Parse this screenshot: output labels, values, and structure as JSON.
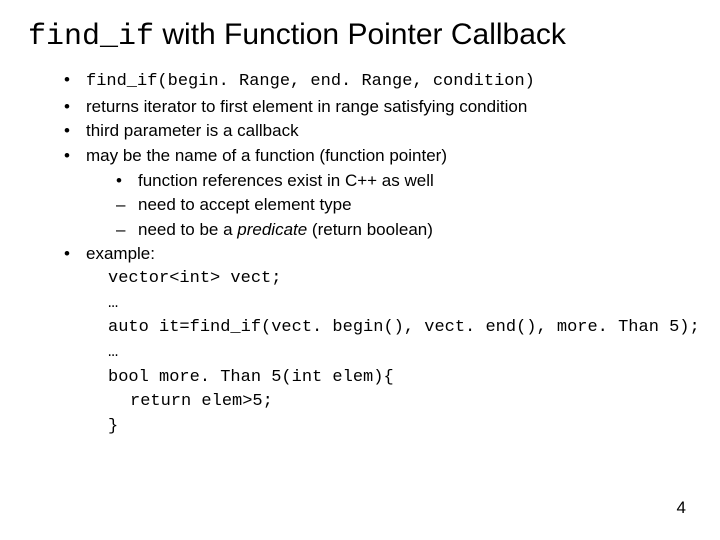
{
  "title": {
    "code": "find_if",
    "rest": " with Function Pointer Callback"
  },
  "bullets": {
    "b1": "find_if(begin. Range, end. Range, condition)",
    "b2": "returns iterator to first element in range satisfying condition",
    "b3": "third parameter is a callback",
    "b4": {
      "main": "may be the name of a function (function pointer)",
      "sub1": "function references exist in C++ as well",
      "sub2": "need to accept element type",
      "sub3_pre": "need to be a ",
      "sub3_em": "predicate",
      "sub3_post": " (return boolean)"
    },
    "b5": {
      "label": "example:",
      "l1": "vector<int> vect;",
      "l2": "…",
      "l3": "auto it=find_if(vect. begin(), vect. end(), more. Than 5);",
      "l4": "…",
      "l5": "bool more. Than 5(int elem){",
      "l6": "return elem>5;",
      "l7": "}"
    }
  },
  "page_number": "4"
}
